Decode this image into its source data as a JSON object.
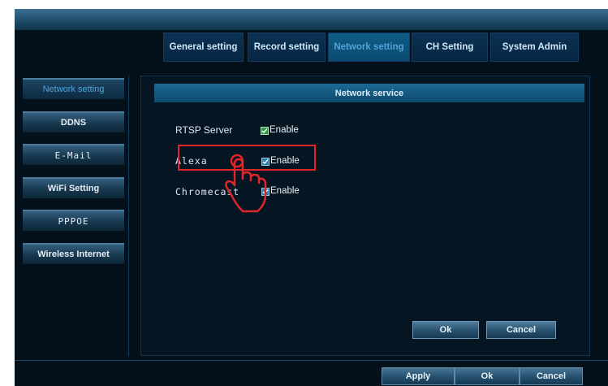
{
  "tabs": [
    {
      "label": "General setting"
    },
    {
      "label": "Record setting"
    },
    {
      "label": "Network setting"
    },
    {
      "label": "CH Setting"
    },
    {
      "label": "System Admin"
    }
  ],
  "active_tab": "Network setting",
  "sidebar": {
    "items": [
      {
        "label": "Network setting"
      },
      {
        "label": "DDNS"
      },
      {
        "label": "E-Mail"
      },
      {
        "label": "WiFi Setting"
      },
      {
        "label": "PPPOE"
      },
      {
        "label": "Wireless Internet"
      }
    ]
  },
  "panel": {
    "title": "Network service",
    "rows": [
      {
        "label": "RTSP Server",
        "checked": true,
        "enable_label": "Enable"
      },
      {
        "label": "Alexa",
        "checked": true,
        "enable_label": "Enable"
      },
      {
        "label": "Chromecast",
        "checked": true,
        "enable_label": "Enable"
      }
    ],
    "ok_label": "Ok",
    "cancel_label": "Cancel"
  },
  "footer": {
    "apply_label": "Apply",
    "ok_label": "Ok",
    "cancel_label": "Cancel"
  },
  "colors": {
    "background": "#04101a",
    "active_tab_text": "#4fa3d8",
    "highlight": "#e0252b"
  }
}
